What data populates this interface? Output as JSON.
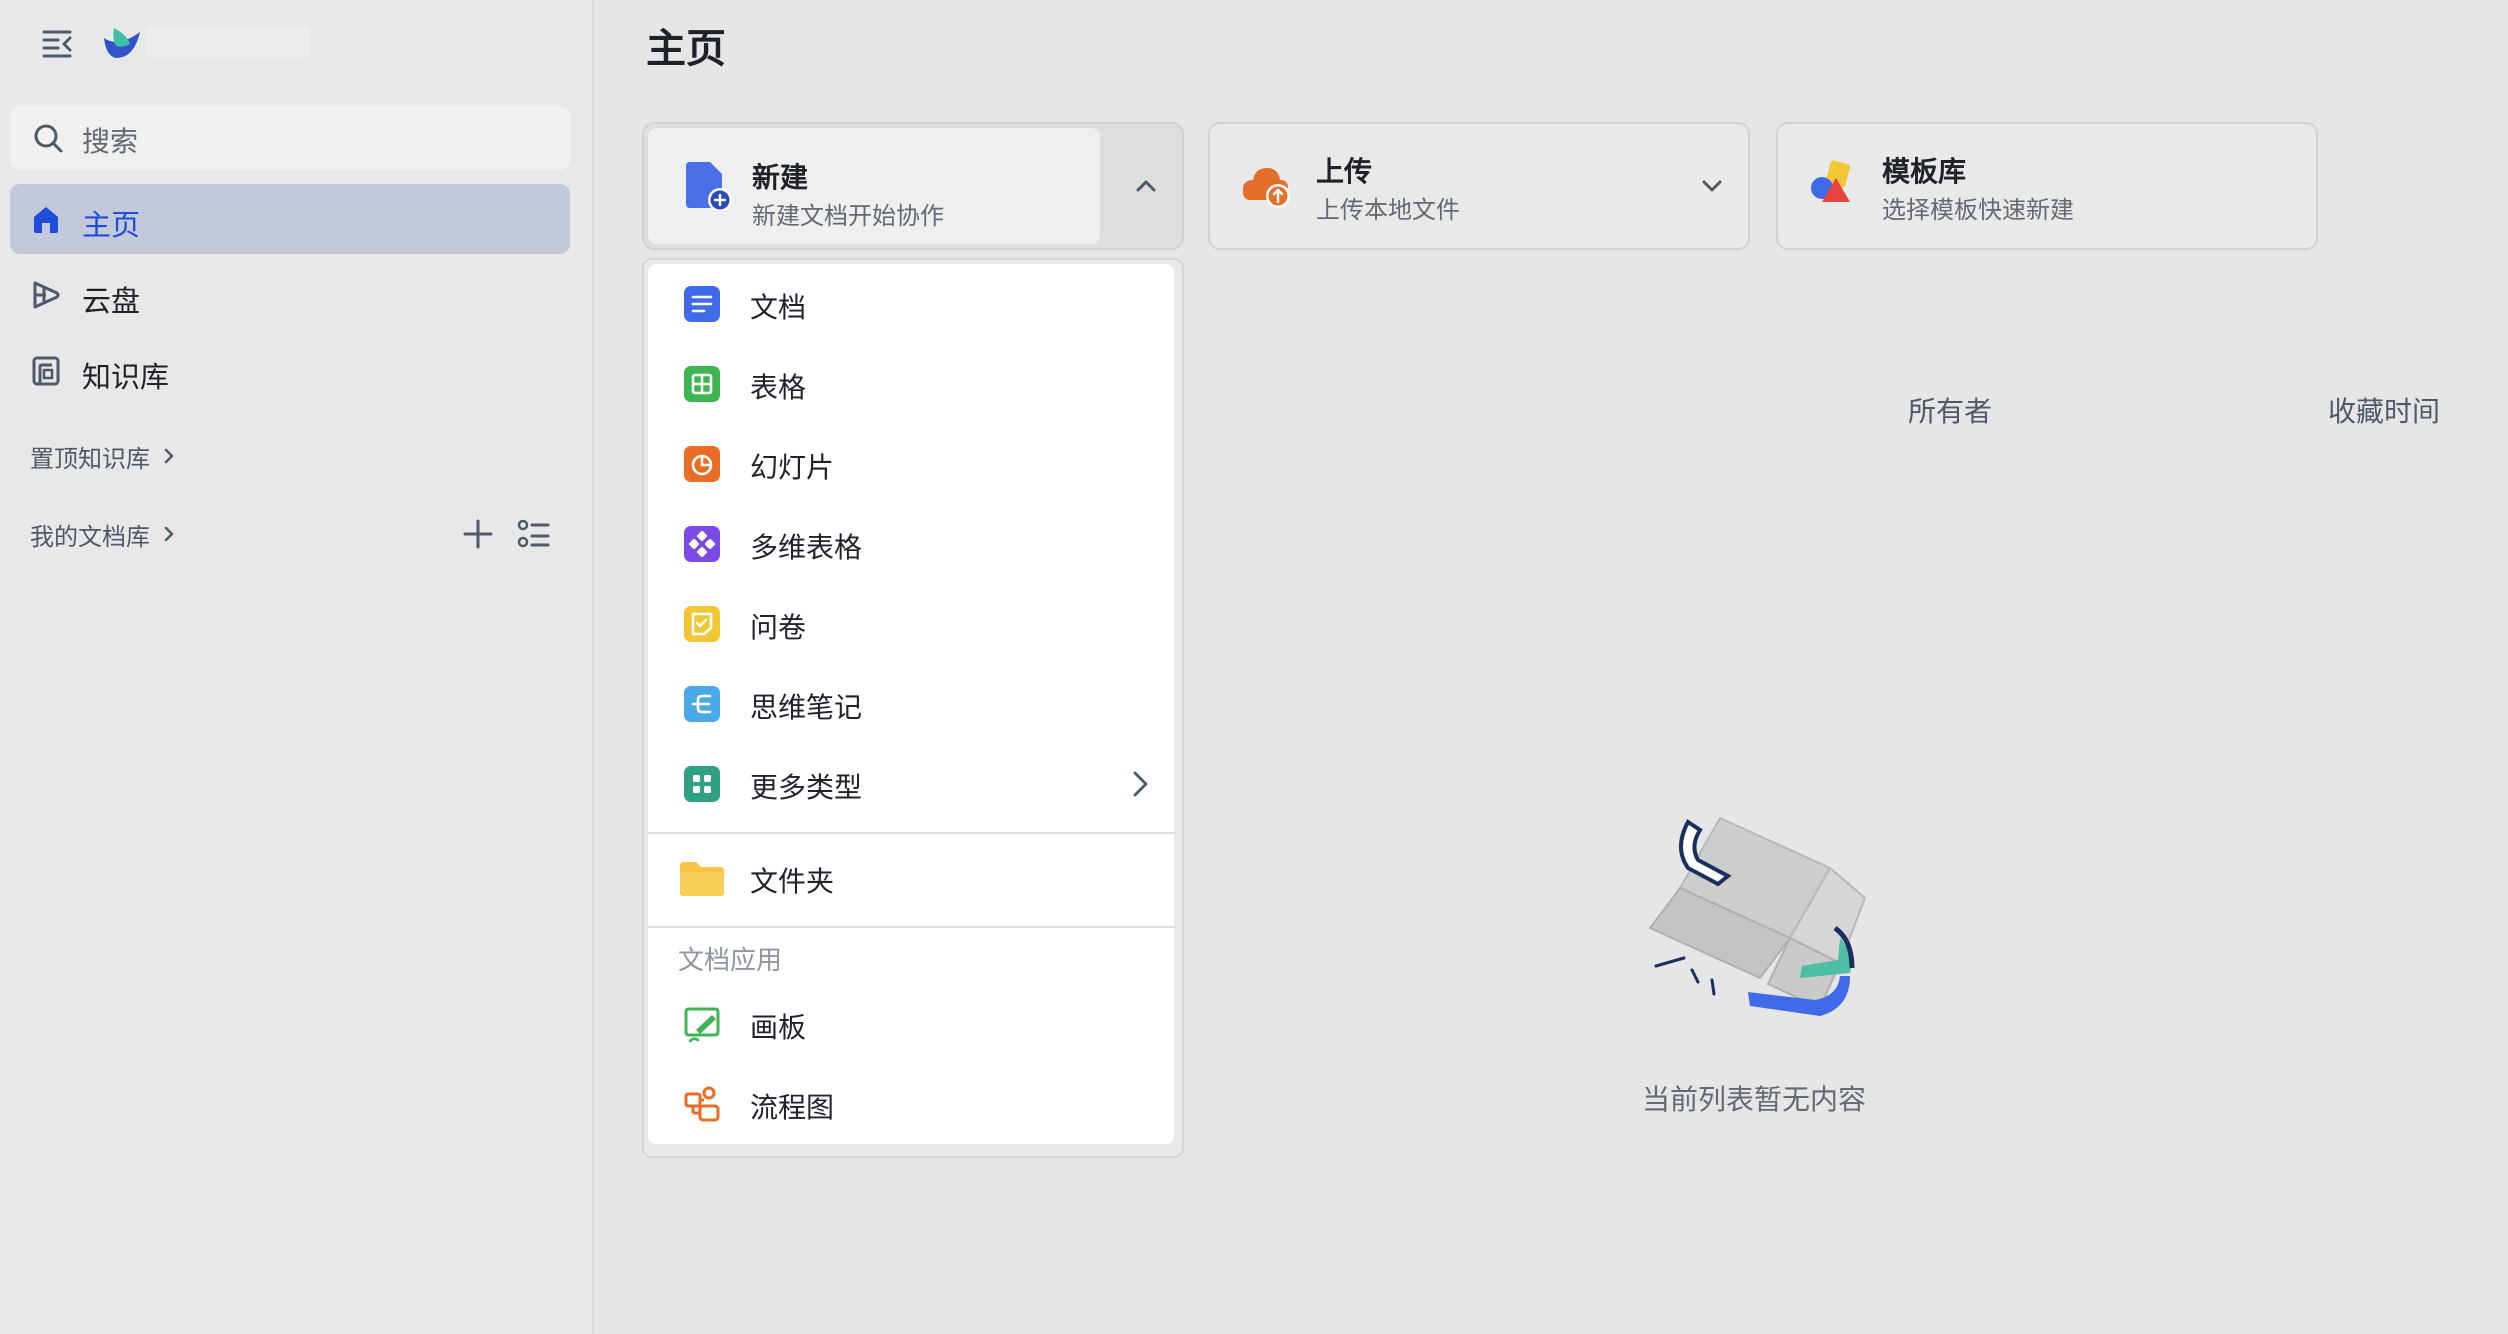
{
  "sidebar": {
    "search_placeholder": "搜索",
    "nav": [
      {
        "label": "主页",
        "icon": "home-icon",
        "active": true
      },
      {
        "label": "云盘",
        "icon": "cloud-drive-icon"
      },
      {
        "label": "知识库",
        "icon": "knowledge-base-icon"
      }
    ],
    "sections": {
      "pinned": "置顶知识库",
      "my_library": "我的文档库"
    }
  },
  "main": {
    "title": "主页",
    "cards": {
      "new": {
        "title": "新建",
        "subtitle": "新建文档开始协作"
      },
      "upload": {
        "title": "上传",
        "subtitle": "上传本地文件"
      },
      "template": {
        "title": "模板库",
        "subtitle": "选择模板快速新建"
      }
    },
    "columns": {
      "owner": "所有者",
      "fav_time": "收藏时间"
    },
    "empty_text": "当前列表暂无内容"
  },
  "dropdown": {
    "items": [
      {
        "label": "文档",
        "icon": "doc-icon"
      },
      {
        "label": "表格",
        "icon": "sheet-icon"
      },
      {
        "label": "幻灯片",
        "icon": "slides-icon"
      },
      {
        "label": "多维表格",
        "icon": "base-icon"
      },
      {
        "label": "问卷",
        "icon": "form-icon"
      },
      {
        "label": "思维笔记",
        "icon": "mindnote-icon"
      },
      {
        "label": "更多类型",
        "icon": "more-types-icon"
      }
    ],
    "folder_label": "文件夹",
    "apps_section": "文档应用",
    "apps": [
      {
        "label": "画板",
        "icon": "whiteboard-icon"
      },
      {
        "label": "流程图",
        "icon": "flowchart-icon"
      }
    ]
  },
  "colors": {
    "accent": "#1d4ed8",
    "active_nav_bg": "#c2c9db",
    "doc": "#3f6ae8",
    "sheet": "#3fb552",
    "slides": "#e96d25",
    "base": "#7b4be6",
    "form": "#f2c736",
    "mindnote": "#4aa9e8",
    "more": "#2f9f85",
    "folder": "#f6c343"
  }
}
